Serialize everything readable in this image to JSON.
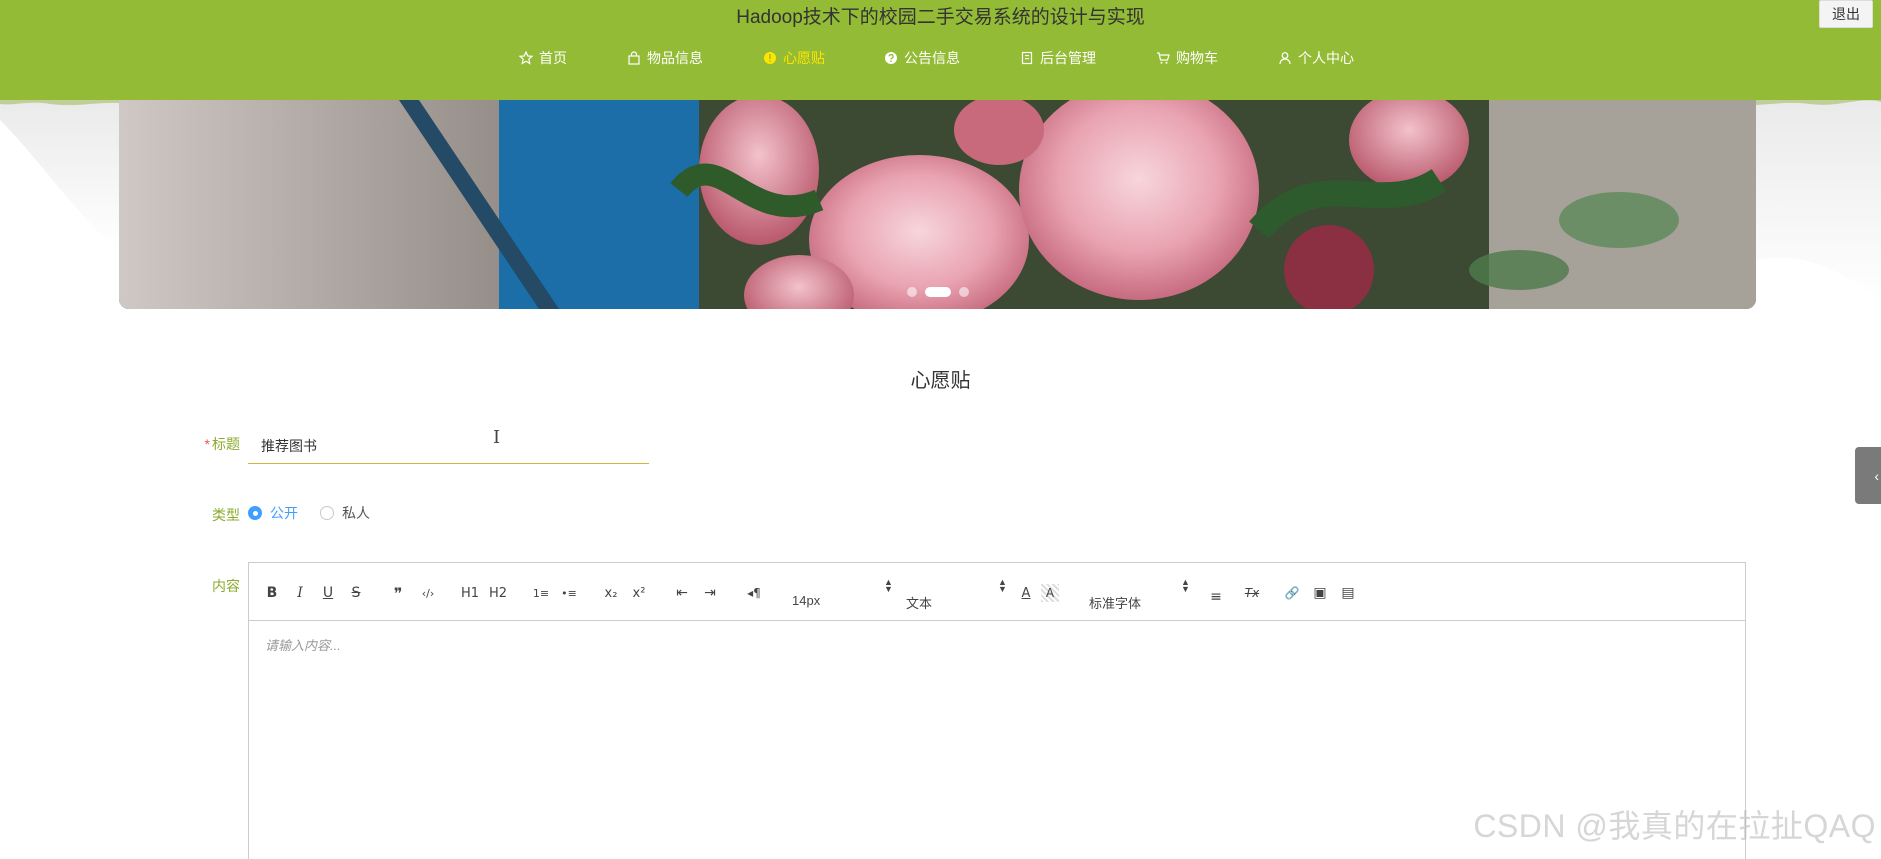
{
  "header": {
    "site_title": "Hadoop技术下的校园二手交易系统的设计与实现",
    "logout_label": "退出",
    "bg_color": "#93bb35",
    "active_color": "#ffe400"
  },
  "nav": {
    "items": [
      {
        "label": "首页",
        "icon": "star-icon",
        "active": false
      },
      {
        "label": "物品信息",
        "icon": "shopping-bag-icon",
        "active": false
      },
      {
        "label": "心愿贴",
        "icon": "info-circle-icon",
        "active": true
      },
      {
        "label": "公告信息",
        "icon": "question-circle-icon",
        "active": false
      },
      {
        "label": "后台管理",
        "icon": "building-icon",
        "active": false
      },
      {
        "label": "购物车",
        "icon": "cart-icon",
        "active": false
      },
      {
        "label": "个人中心",
        "icon": "user-icon",
        "active": false
      }
    ]
  },
  "banner": {
    "slide_count": 3,
    "active_slide": 2
  },
  "page": {
    "title": "心愿贴"
  },
  "form": {
    "title_label": "标题",
    "title_required_mark": "*",
    "title_value": "推荐图书",
    "type_label": "类型",
    "type_options": [
      {
        "label": "公开",
        "checked": true
      },
      {
        "label": "私人",
        "checked": false
      }
    ],
    "content_label": "内容"
  },
  "editor": {
    "toolbar": {
      "bold": "B",
      "italic": "I",
      "underline": "U",
      "strike": "S",
      "blockquote": "❞",
      "code": "‹/›",
      "h1": "H1",
      "h2": "H2",
      "ordered_list": "1≡",
      "bullet_list": "•≡",
      "subscript": "x₂",
      "superscript": "x²",
      "outdent": "⇤",
      "indent": "⇥",
      "direction": "◂¶",
      "font_size": "14px",
      "header_select": "文本",
      "text_color": "A",
      "background_color": "A",
      "font_family": "标准字体",
      "align": "≡",
      "clean": "Tx",
      "link": "🔗",
      "image": "▣",
      "video": "▤"
    },
    "placeholder": "请输入内容..."
  },
  "side_tab": {
    "glyph": "‹"
  },
  "watermark": "CSDN @我真的在拉扯QAQ"
}
